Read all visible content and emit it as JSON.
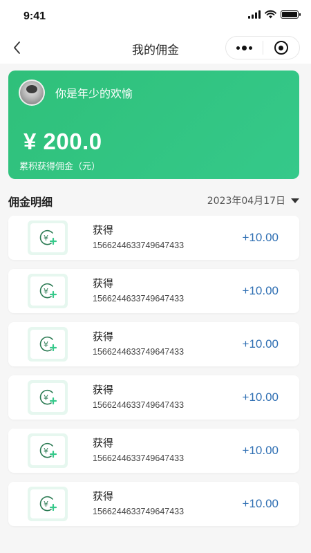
{
  "status_bar": {
    "time": "9:41"
  },
  "nav": {
    "title": "我的佣金"
  },
  "profile": {
    "username": "你是年少的欢愉"
  },
  "commission": {
    "amount": "¥ 200.0",
    "label": "累积获得佣金（元）"
  },
  "details": {
    "title": "佣金明细",
    "date": "2023年04月17日",
    "items": [
      {
        "title": "获得",
        "order_no": "1566244633749647433",
        "amount": "+10.00"
      },
      {
        "title": "获得",
        "order_no": "1566244633749647433",
        "amount": "+10.00"
      },
      {
        "title": "获得",
        "order_no": "1566244633749647433",
        "amount": "+10.00"
      },
      {
        "title": "获得",
        "order_no": "1566244633749647433",
        "amount": "+10.00"
      },
      {
        "title": "获得",
        "order_no": "1566244633749647433",
        "amount": "+10.00"
      },
      {
        "title": "获得",
        "order_no": "1566244633749647433",
        "amount": "+10.00"
      }
    ]
  },
  "icons": {
    "back": "chevron-left-icon",
    "more": "more-dots-icon",
    "close": "target-circle-icon",
    "row": "yuan-add-icon",
    "dropdown": "caret-down-icon"
  },
  "colors": {
    "accent": "#33c47f",
    "amount": "#2f6fb3",
    "icon_bg": "#e6f7ef",
    "icon_stroke": "#2a7a52"
  }
}
